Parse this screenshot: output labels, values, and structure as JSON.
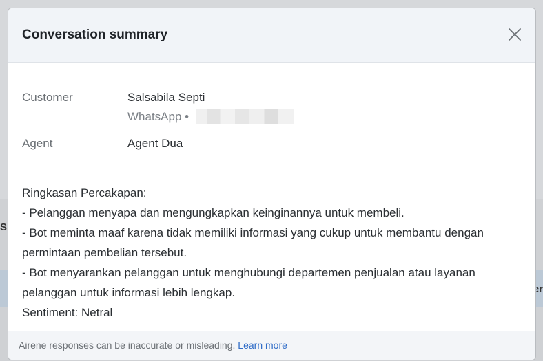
{
  "modal": {
    "title": "Conversation summary",
    "close_icon": "close-icon"
  },
  "customer": {
    "label": "Customer",
    "name": "Salsabila Septi",
    "channel": "WhatsApp •"
  },
  "agent": {
    "label": "Agent",
    "name": "Agent Dua"
  },
  "summary": {
    "lines": [
      "Ringkasan Percakapan:",
      "- Pelanggan menyapa dan mengungkapkan keinginannya untuk membeli.",
      "- Bot meminta maaf karena tidak memiliki informasi yang cukup untuk membantu dengan permintaan pembelian tersebut.",
      "- Bot menyarankan pelanggan untuk menghubungi departemen penjualan atau layanan pelanggan untuk informasi lebih lengkap.",
      "Sentiment: Netral"
    ]
  },
  "footer": {
    "disclaimer": "Airene responses can be inaccurate or misleading.",
    "link": "Learn more"
  },
  "background": {
    "left_letter": "S",
    "right_letter": "er"
  },
  "colors": {
    "accent_link": "#2f6cc7",
    "header_bg": "#f1f4f8"
  }
}
